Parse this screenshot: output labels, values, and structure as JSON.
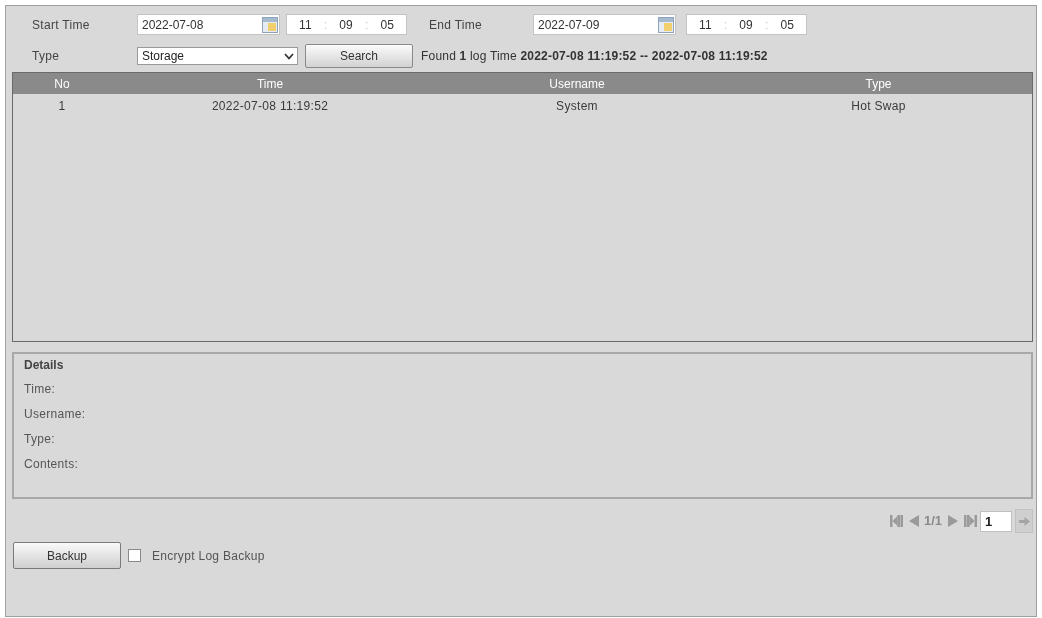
{
  "filters": {
    "start": {
      "label": "Start Time",
      "date": "2022-07-08",
      "time": [
        "11",
        ":",
        "09",
        ":",
        "05"
      ]
    },
    "end": {
      "label": "End Time",
      "date": "2022-07-09",
      "time": [
        "11",
        ":",
        "09",
        ":",
        "05"
      ]
    },
    "type": {
      "label": "Type",
      "value": "Storage"
    },
    "search_button": "Search",
    "result": "Found **1** log Time **2022-07-08 11:19:52 -- 2022-07-08 11:19:52**"
  },
  "table": {
    "columns": [
      "No",
      "Time",
      "Username",
      "Type"
    ],
    "rows": [
      {
        "cells": [
          "1",
          "2022-07-08 11:19:52",
          "System",
          "Hot Swap"
        ],
        "selected": false
      }
    ]
  },
  "details": {
    "title": "Details",
    "fields": [
      "Time:",
      "Username:",
      "Type:",
      "Contents:"
    ]
  },
  "pagination": {
    "page": "1/1",
    "page_input": "1"
  },
  "backup": {
    "button": "Backup",
    "encrypt": {
      "label": "Encrypt Log Backup",
      "checked": false
    }
  }
}
